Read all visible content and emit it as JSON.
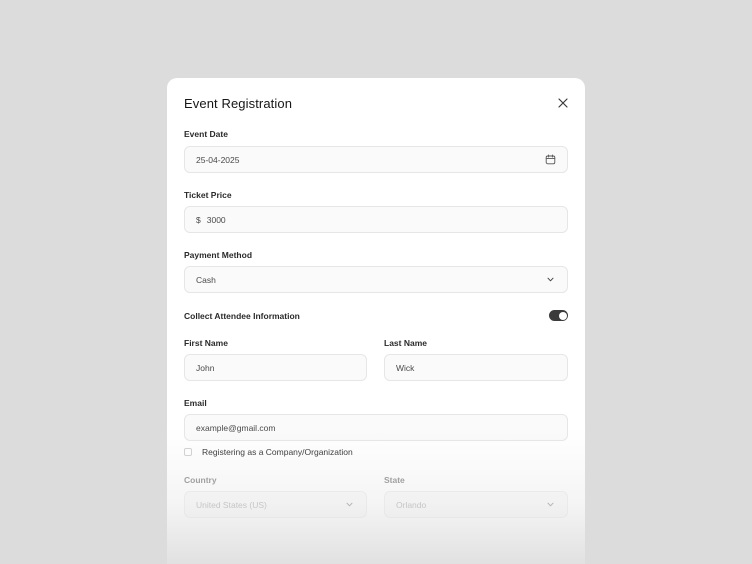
{
  "dialog": {
    "title": "Event Registration"
  },
  "event_date": {
    "label": "Event Date",
    "value": "25-04-2025",
    "icon": "calendar-icon"
  },
  "ticket_price": {
    "label": "Ticket Price",
    "currency": "$",
    "value": "3000"
  },
  "payment_method": {
    "label": "Payment Method",
    "value": "Cash",
    "icon": "chevron-down-icon"
  },
  "attendee": {
    "toggle_label": "Collect Attendee Information",
    "toggle_on": true
  },
  "first_name": {
    "label": "First Name",
    "value": "John"
  },
  "last_name": {
    "label": "Last Name",
    "value": "Wick"
  },
  "email": {
    "label": "Email",
    "placeholder": "example@gmail.com"
  },
  "company": {
    "label": "Registering as a Company/Organization",
    "checked": false
  },
  "country": {
    "label": "Country",
    "value": "United States (US)"
  },
  "state": {
    "label": "State",
    "value": "Orlando"
  },
  "colors": {
    "background": "#dcdcdc",
    "card": "#ffffff",
    "toggle_on": "#3b3b3b",
    "field_bg": "#fafafa",
    "field_border": "#e6e6e6"
  }
}
